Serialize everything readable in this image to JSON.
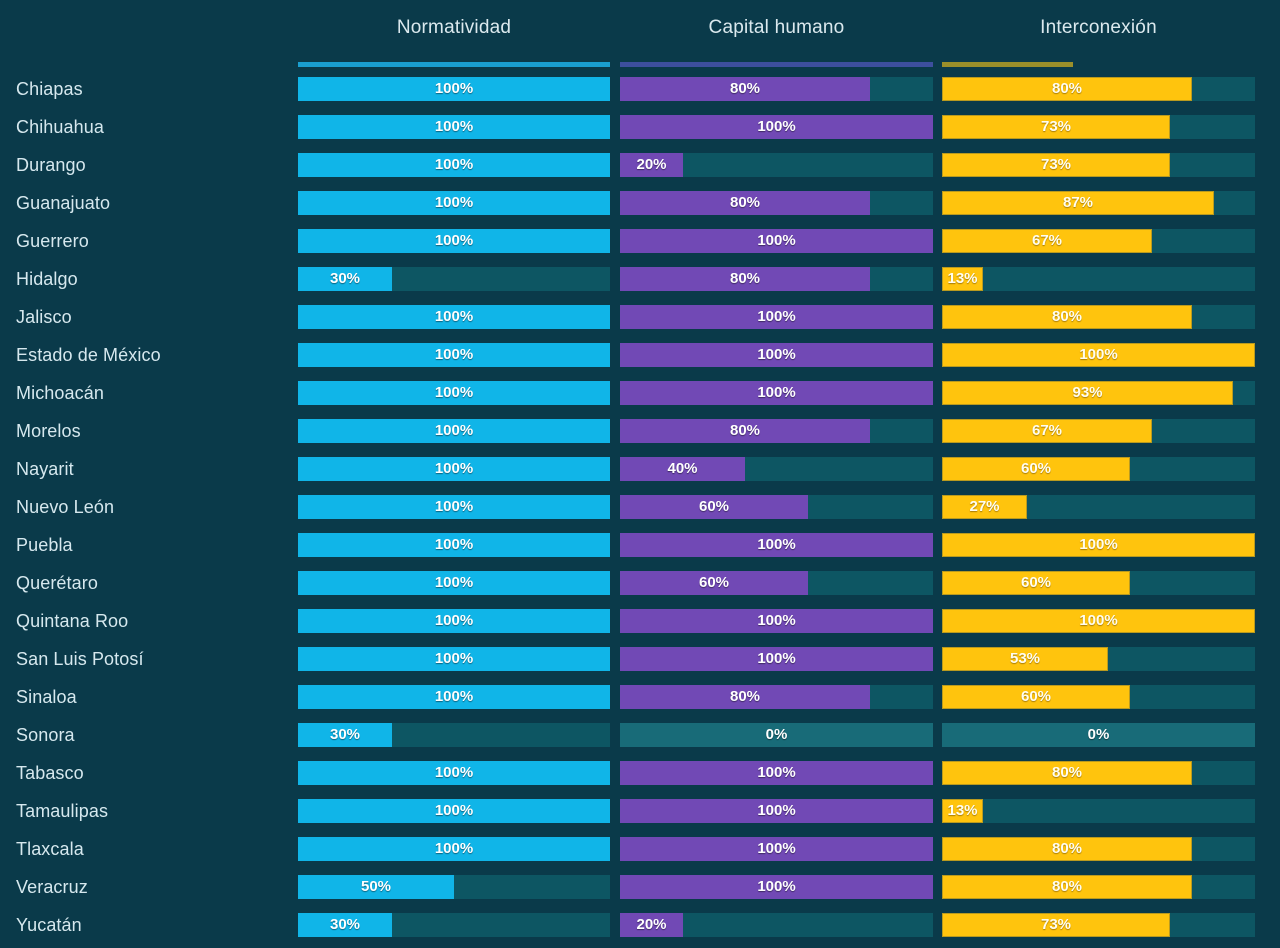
{
  "theme": {
    "background": "#0a3a4a",
    "track": "#0d5663",
    "track_zero": "#186b78",
    "normatividad_color": "#10b5e8",
    "capital_humano_color": "#7149b5",
    "interconexion_color": "#ffc40d",
    "label_color": "#d6e8ee"
  },
  "columns": [
    {
      "key": "normatividad",
      "label": "Normatividad"
    },
    {
      "key": "capital_humano",
      "label": "Capital humano"
    },
    {
      "key": "interconexion",
      "label": "Interconexión"
    }
  ],
  "chart_data": {
    "type": "bar",
    "title": "",
    "subtitle": "",
    "xlabel": "",
    "ylabel": "",
    "xlim": [
      0,
      100
    ],
    "grid": false,
    "legend_position": "top",
    "orientation": "horizontal",
    "value_suffix": "%",
    "categories": [
      "Chiapas",
      "Chihuahua",
      "Durango",
      "Guanajuato",
      "Guerrero",
      "Hidalgo",
      "Jalisco",
      "Estado de México",
      "Michoacán",
      "Morelos",
      "Nayarit",
      "Nuevo León",
      "Puebla",
      "Querétaro",
      "Quintana Roo",
      "San Luis Potosí",
      "Sinaloa",
      "Sonora",
      "Tabasco",
      "Tamaulipas",
      "Tlaxcala",
      "Veracruz",
      "Yucatán"
    ],
    "series": [
      {
        "name": "Normatividad",
        "color": "#10b5e8",
        "values": [
          100,
          100,
          100,
          100,
          100,
          30,
          100,
          100,
          100,
          100,
          100,
          100,
          100,
          100,
          100,
          100,
          100,
          30,
          100,
          100,
          100,
          50,
          30
        ],
        "labels": [
          "100%",
          "100%",
          "100%",
          "100%",
          "100%",
          "30%",
          "100%",
          "100%",
          "100%",
          "100%",
          "100%",
          "100%",
          "100%",
          "100%",
          "100%",
          "100%",
          "100%",
          "30%",
          "100%",
          "100%",
          "100%",
          "50%",
          "30%"
        ]
      },
      {
        "name": "Capital humano",
        "color": "#7149b5",
        "values": [
          80,
          100,
          20,
          80,
          100,
          80,
          100,
          100,
          100,
          80,
          40,
          60,
          100,
          60,
          100,
          100,
          80,
          0,
          100,
          100,
          100,
          100,
          20
        ],
        "labels": [
          "80%",
          "100%",
          "20%",
          "80%",
          "100%",
          "80%",
          "100%",
          "100%",
          "100%",
          "80%",
          "40%",
          "60%",
          "100%",
          "60%",
          "100%",
          "100%",
          "80%",
          "0%",
          "100%",
          "100%",
          "100%",
          "100%",
          "20%"
        ]
      },
      {
        "name": "Interconexión",
        "color": "#ffc40d",
        "values": [
          80,
          73,
          73,
          87,
          67,
          13,
          80,
          100,
          93,
          67,
          60,
          27,
          100,
          60,
          100,
          53,
          60,
          0,
          80,
          13,
          80,
          80,
          73
        ],
        "labels": [
          "80%",
          "73%",
          "73%",
          "87%",
          "67%",
          "13%",
          "80%",
          "100%",
          "93%",
          "67%",
          "60%",
          "27%",
          "100%",
          "60%",
          "100%",
          "53%",
          "60%",
          "0%",
          "80%",
          "13%",
          "80%",
          "80%",
          "73%"
        ]
      }
    ]
  }
}
